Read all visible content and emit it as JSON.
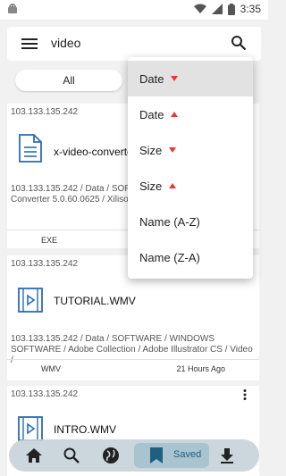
{
  "status_bar": {
    "time": "3:35",
    "icons": [
      "android-icon",
      "wifi-icon",
      "signal-icon",
      "battery-icon"
    ]
  },
  "search": {
    "query": "video"
  },
  "filter": {
    "selected": "All"
  },
  "results": [
    {
      "ip": "103.133.135.242",
      "file_name": "x-video-converter",
      "path": "103.133.135.242 / Data / SOFTWARE / Xilisoft Video Converter 5.0.60.0625 / Xilisoft_Video_Converter_5.0",
      "type": "EXE",
      "time": "",
      "icon": "document-icon"
    },
    {
      "ip": "103.133.135.242",
      "file_name": "TUTORIAL.WMV",
      "path": "103.133.135.242 / Data / SOFTWARE / WINDOWS SOFTWARE / Adobe Collection / Adobe Illustrator CS / Video /",
      "type": "WMV",
      "time": "21 Hours Ago",
      "icon": "video-file-icon"
    },
    {
      "ip": "103.133.135.242",
      "file_name": "INTRO.WMV",
      "icon": "video-file-icon"
    }
  ],
  "sort_menu": {
    "items": [
      {
        "label": "Date",
        "arrow": "down",
        "selected": true
      },
      {
        "label": "Date",
        "arrow": "up",
        "selected": false
      },
      {
        "label": "Size",
        "arrow": "down",
        "selected": false
      },
      {
        "label": "Size",
        "arrow": "up",
        "selected": false
      },
      {
        "label": "Name (A-Z)",
        "arrow": "",
        "selected": false
      },
      {
        "label": "Name (Z-A)",
        "arrow": "",
        "selected": false
      }
    ],
    "arrow_color": "#e53935"
  },
  "bottom_nav": {
    "items": [
      "home-icon",
      "search-icon",
      "globe-icon",
      "bookmark-icon",
      "download-icon"
    ],
    "saved_label": "Saved",
    "active_color": "#1e5f82"
  }
}
